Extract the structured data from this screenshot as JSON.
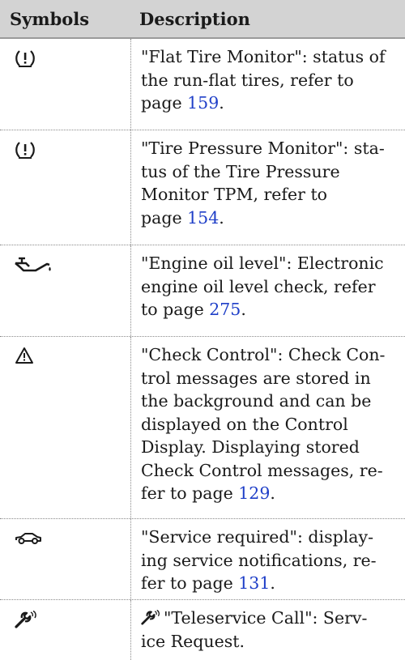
{
  "table": {
    "headers": {
      "symbols": "Symbols",
      "description": "Description"
    },
    "rows": [
      {
        "icon": "flat-tire-warning-icon",
        "lines": [
          "\"Flat Tire Monitor\": status of",
          "the run-flat tires, refer to"
        ],
        "page_prefix": "page ",
        "page": "159",
        "suffix": "."
      },
      {
        "icon": "tire-pressure-warning-icon",
        "lines": [
          "\"Tire Pressure Monitor\": sta-",
          "tus of the Tire Pressure",
          "Monitor TPM, refer to"
        ],
        "page_prefix": "page ",
        "page": "154",
        "suffix": "."
      },
      {
        "icon": "engine-oil-icon",
        "lines": [
          "\"Engine oil level\": Electronic",
          "engine oil level check, refer"
        ],
        "page_prefix": "to page ",
        "page": "275",
        "suffix": "."
      },
      {
        "icon": "warning-triangle-icon",
        "lines": [
          "\"Check Control\": Check Con-",
          "trol messages are stored in",
          "the background and can be",
          "displayed on the Control",
          "Display. Displaying stored",
          "Check Control messages, re-"
        ],
        "page_prefix": "fer to page ",
        "page": "129",
        "suffix": "."
      },
      {
        "icon": "service-car-icon",
        "lines": [
          "\"Service required\": display-",
          "ing service notifications, re-"
        ],
        "page_prefix": "fer to page ",
        "page": "131",
        "suffix": "."
      },
      {
        "icon": "teleservice-wrench-icon",
        "line1": "\"Teleservice Call\": Serv-",
        "line2": "ice Request."
      }
    ]
  }
}
